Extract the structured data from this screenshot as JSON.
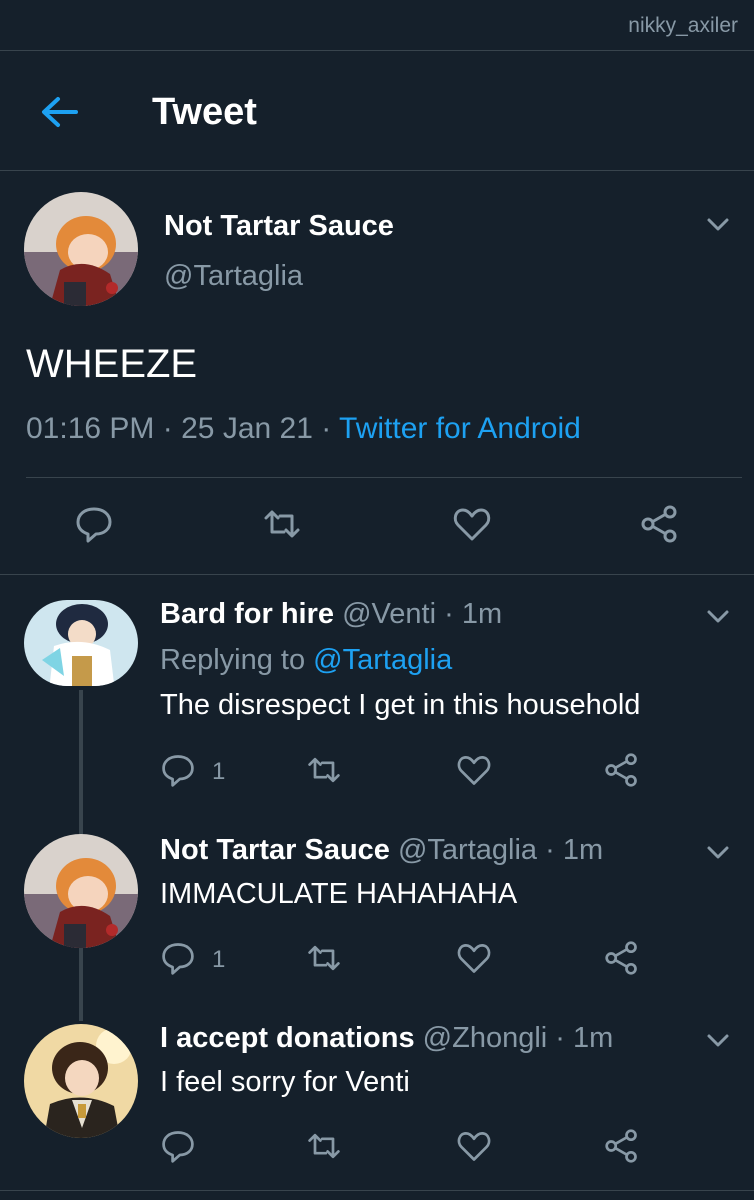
{
  "watermark": "nikky_axiler",
  "header": {
    "title": "Tweet"
  },
  "main_tweet": {
    "name": "Not Tartar Sauce",
    "handle": "@Tartaglia",
    "text": "WHEEZE",
    "time": "01:16 PM",
    "dot1": "·",
    "date": "25 Jan 21",
    "dot2": "·",
    "source": "Twitter for Android"
  },
  "replies": [
    {
      "name": "Bard for hire",
      "handle": "@Venti",
      "dot": "·",
      "time": "1m",
      "replying_prefix": "Replying to",
      "replying_to": "@Tartaglia",
      "text": "The disrespect I get in this household",
      "reply_count": "1"
    },
    {
      "name": "Not Tartar Sauce",
      "handle": "@Tartaglia",
      "dot": "·",
      "time": "1m",
      "text": "IMMACULATE HAHAHAHA",
      "reply_count": "1"
    },
    {
      "name": "I accept donations",
      "handle": "@Zhongli",
      "dot": "·",
      "time": "1m",
      "text": "I feel sorry for Venti",
      "reply_count": ""
    }
  ],
  "colors": {
    "background": "#15202b",
    "accent": "#1da1f2",
    "muted": "#8899a6",
    "divider": "#38444d"
  },
  "icons": [
    "back-arrow-icon",
    "chevron-down-icon",
    "reply-icon",
    "retweet-icon",
    "like-icon",
    "share-icon"
  ]
}
